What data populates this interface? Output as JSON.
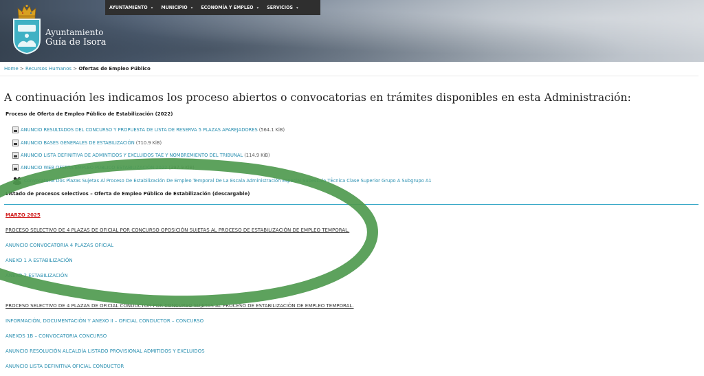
{
  "header": {
    "logo_line1": "Ayuntamiento",
    "logo_line2": "Guía de Isora",
    "nav": [
      {
        "label": "AYUNTAMIENTO"
      },
      {
        "label": "MUNICIPIO"
      },
      {
        "label": "ECONOMÍA Y EMPLEO"
      },
      {
        "label": "SERVICIOS"
      }
    ]
  },
  "breadcrumb": {
    "home": "Home",
    "sep1": " > ",
    "section": "Recursos Humanos",
    "sep2": " > ",
    "current": "Ofertas de Empleo Público"
  },
  "main": {
    "heading": "A continuación les indicamos los proceso abiertos o convocatorias en trámites disponibles en esta Administración:",
    "subheading": "Proceso de Oferta de Empleo Público de Estabilización (2022)",
    "documents": [
      {
        "label": "ANUNCIO RESULTADOS DEL CONCURSO Y PROPUESTA DE LISTA DE RESERVA 5 PLAZAS APAREJADORES",
        "size": "(564.1 KiB)"
      },
      {
        "label": "ANUNCIO BASES GENERALES DE ESTABILIZACIÓN",
        "size": "(710.9 KiB)"
      },
      {
        "label": "ANUNCIO LISTA DEFINITIVA DE ADMINTIDOS Y EXCLUIDOS TAE Y NOMBREMIENTO DEL TRIBUNAL",
        "size": "(114.9 KiB)"
      },
      {
        "label": "ANUNCIO WEB OFERTA EMPLEO PÚBLICO ESTABILIZACIÓN 2022",
        "size": "(397.9 KiB)"
      }
    ],
    "convocatoria": "Convocatoria Dos Plazas Sujetas Al Proceso De Estabilización De Empleo Temporal De La Escala Administración Especial Subescala TÉcnica Clase Superior Grupo A Subgrupo A1",
    "listado": "Listado de procesos selectivos –  Oferta de Empleo Público de Estabilización (descargable)",
    "marzo": "MARZO 2025",
    "process1": "PROCESO SELECTIVO DE 4 PLAZAS DE OFICIAL POR CONCURSO OPOSICIÓN SUJETAS AL PROCESO DE ESTABILIZACIÓN DE EMPLEO TEMPORAL.",
    "links1": [
      "ANUNCIO CONVOCATORIA 4 PLAZAS OFICIAL",
      "ANEXO 1 A ESTABILIZACIÓN",
      "ANEXO 2 ESTABILIZACIÓN"
    ],
    "process2": "PROCESO SELECTIVO DE 4 PLAZAS DE OFICIAL CONDUCTOR POR CONCURSO SUJETAS AL PROCESO DE ESTABILIZACIÓN DE EMPLEO TEMPORAL.",
    "links2": [
      "INFORMACIÓN, DOCUMENTACIÓN Y ANEXO II – OFICIAL CONDUCTOR – CONCURSO",
      "ANEXOS 1B – CONVOCATORIA CONCURSO",
      "ANUNCIO RESOLUCIÓN ALCALDÍA LISTADO PROVISIONAL ADMITIDOS Y EXCLUIDOS",
      "ANUNCIO LISTA DEFINITIVA OFICIAL CONDUCTOR"
    ]
  },
  "colors": {
    "link": "#2a8fb0",
    "nav_bg": "#2f2f2f",
    "accent_red": "#d11f1f",
    "annotation_green": "#4f9a4f"
  }
}
